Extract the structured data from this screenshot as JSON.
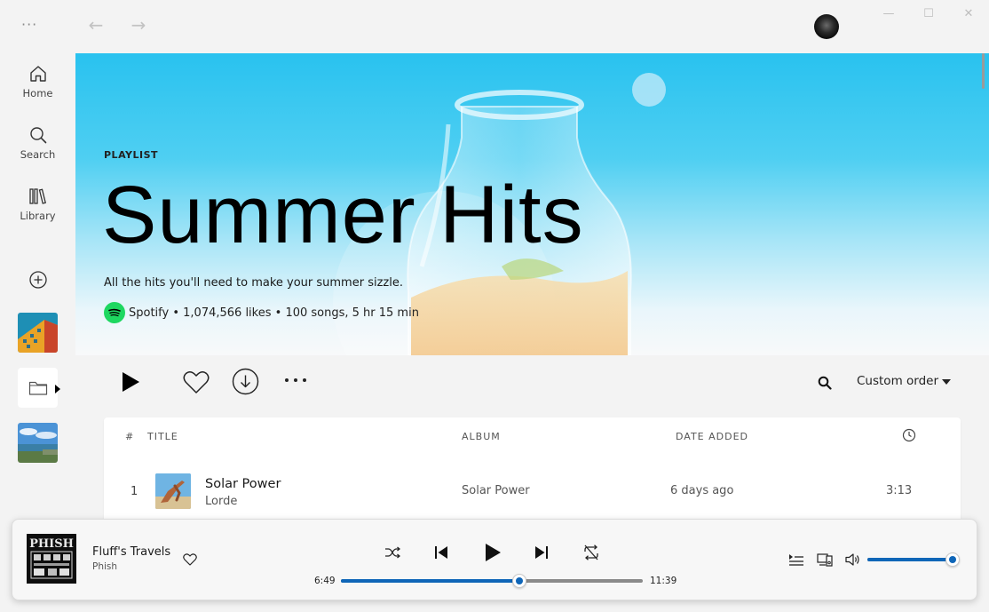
{
  "titlebar": {
    "menu_glyph": "···",
    "back_glyph": "←",
    "forward_glyph": "→",
    "minimize_glyph": "—",
    "maximize_glyph": "☐",
    "close_glyph": "✕"
  },
  "sidebar": {
    "items": [
      {
        "label": "Home",
        "icon": "home-icon"
      },
      {
        "label": "Search",
        "icon": "search-icon"
      },
      {
        "label": "Library",
        "icon": "library-icon"
      }
    ],
    "add_icon": "plus-circle-icon"
  },
  "hero": {
    "kind": "PLAYLIST",
    "title": "Summer Hits",
    "description": "All the hits you'll need to make your summer sizzle.",
    "owner": "Spotify",
    "stats": " • 1,074,566 likes • 100 songs, 5 hr 15 min"
  },
  "actions": {
    "sort_label": "Custom order"
  },
  "table": {
    "headers": {
      "index": "#",
      "title": "TITLE",
      "album": "ALBUM",
      "date_added": "DATE ADDED"
    },
    "rows": [
      {
        "index": "1",
        "title": "Solar Power",
        "artist": "Lorde",
        "album": "Solar Power",
        "date_added": "6 days ago",
        "duration": "3:13"
      }
    ]
  },
  "player": {
    "track_title": "Fluff's Travels",
    "artist": "Phish",
    "album_art_text": "PHISH",
    "elapsed": "6:49",
    "total": "11:39",
    "progress_fraction": 0.59,
    "volume_fraction": 1.0
  },
  "colors": {
    "accent": "#0f66b8",
    "spotify_green": "#1ed760",
    "hero_top": "#29c2ef"
  }
}
